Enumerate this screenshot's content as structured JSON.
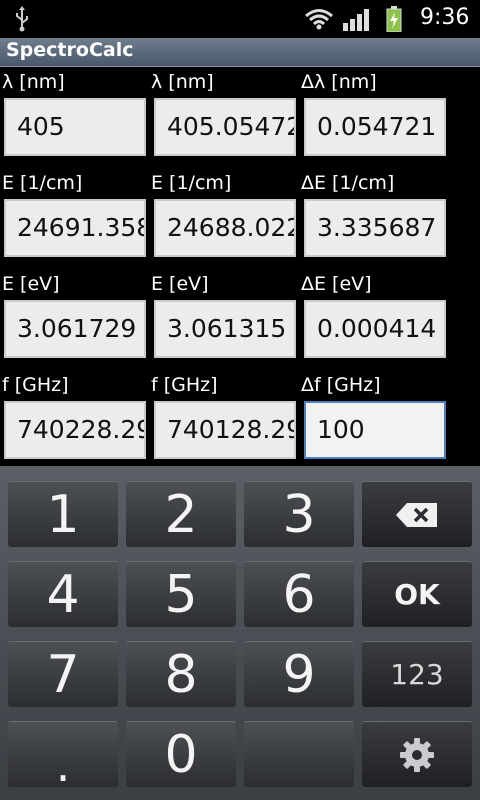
{
  "status_bar": {
    "time": "9:36"
  },
  "app": {
    "title": "SpectroCalc"
  },
  "rows": [
    {
      "labels": [
        "λ [nm]",
        "λ [nm]",
        "Δλ [nm]"
      ],
      "values": [
        "405",
        "405.05472",
        "0.054721"
      ]
    },
    {
      "labels": [
        "E [1/cm]",
        "E [1/cm]",
        "ΔE [1/cm]"
      ],
      "values": [
        "24691.358",
        "24688.022",
        "3.335687"
      ]
    },
    {
      "labels": [
        "E [eV]",
        "E [eV]",
        "ΔE [eV]"
      ],
      "values": [
        "3.061729",
        "3.061315",
        "0.000414"
      ]
    },
    {
      "labels": [
        "f [GHz]",
        "f [GHz]",
        "Δf [GHz]"
      ],
      "values": [
        "740228.29",
        "740128.29",
        "100"
      ]
    }
  ],
  "keyboard": {
    "keys": [
      "1",
      "2",
      "3",
      "4",
      "5",
      "6",
      "7",
      "8",
      "9",
      ".",
      "0"
    ],
    "ok_label": "OK",
    "mode_label": "123",
    "icons": {
      "backspace": "backspace-icon",
      "settings": "gear-icon"
    }
  }
}
